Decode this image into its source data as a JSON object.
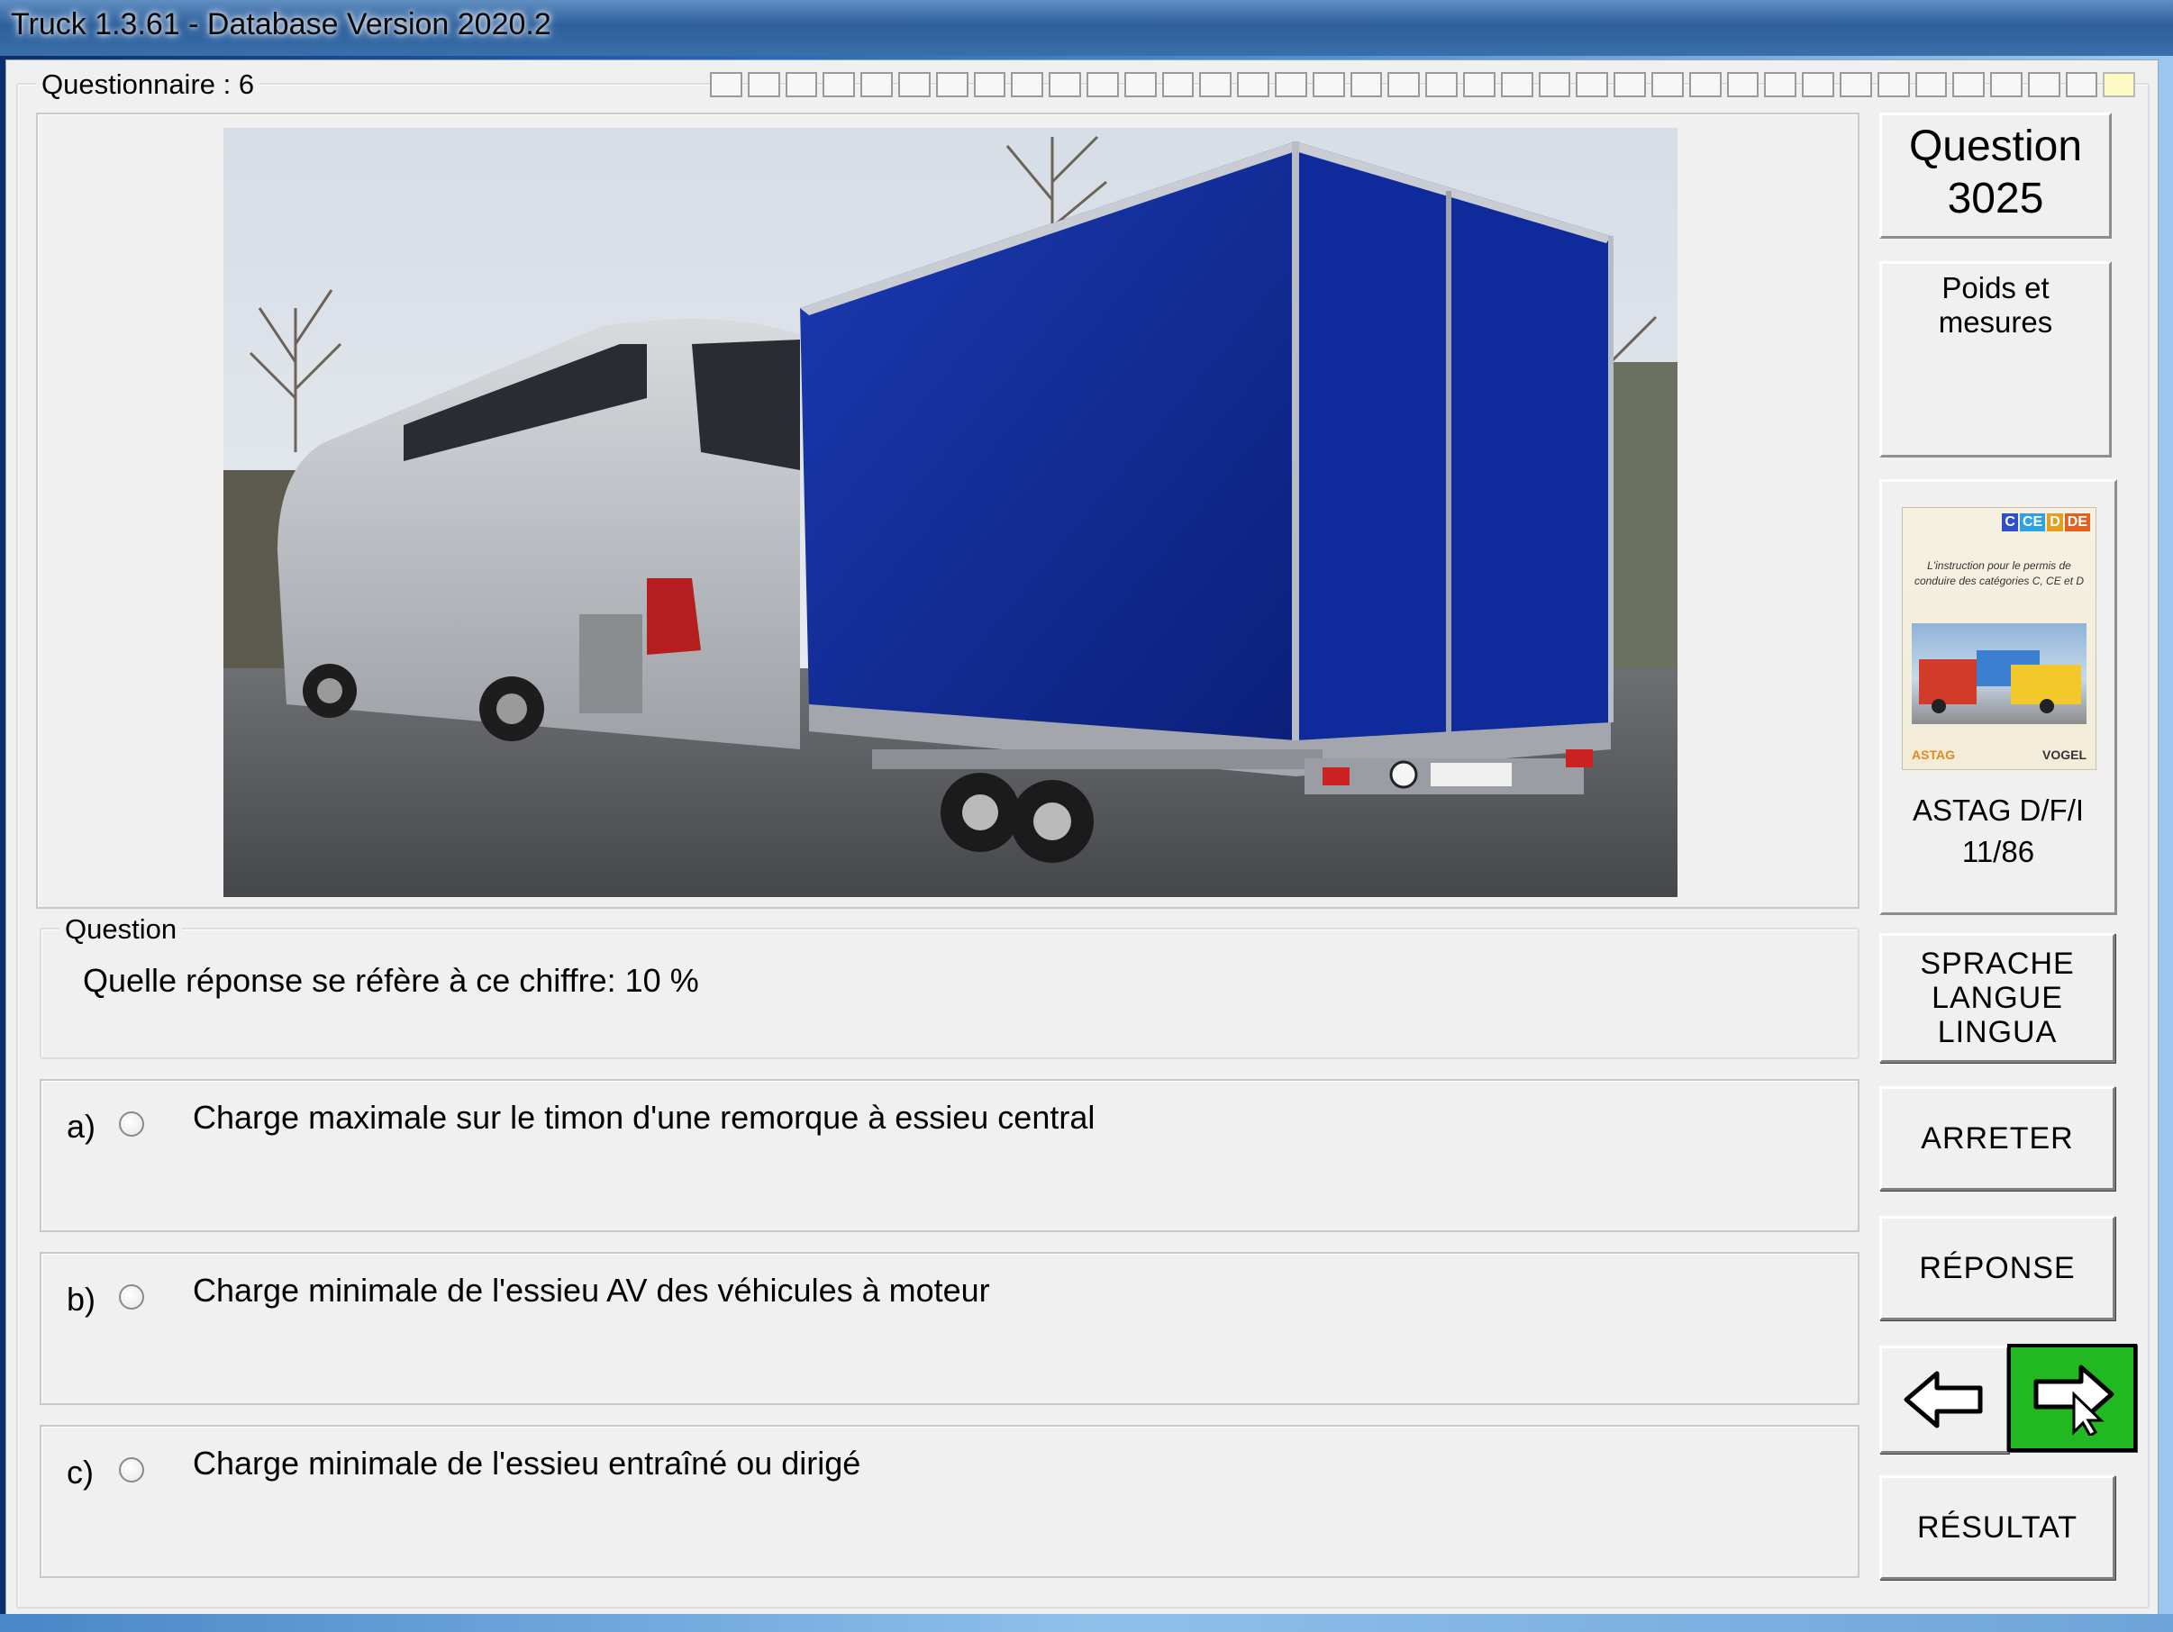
{
  "window": {
    "title": "Truck 1.3.61 - Database Version 2020.2"
  },
  "questionnaire": {
    "label": "Questionnaire : 6",
    "progress_total": 38,
    "progress_current": 38
  },
  "question_box": {
    "title_line1": "Question",
    "number": "3025",
    "category": "Poids et mesures"
  },
  "book": {
    "tags": [
      "C",
      "CE",
      "D",
      "DE"
    ],
    "cover_text": "L'instruction pour le permis de conduire des catégories C, CE et D",
    "logo_left": "ASTAG",
    "logo_right": "VOGEL",
    "caption_line1": "ASTAG D/F/I",
    "caption_line2": "11/86"
  },
  "question": {
    "group_label": "Question",
    "text": "Quelle réponse se réfère à ce chiffre:  10 %"
  },
  "answers": [
    {
      "letter": "a)",
      "text": "Charge maximale sur le timon d'une remorque à essieu central"
    },
    {
      "letter": "b)",
      "text": "Charge minimale de l'essieu AV des véhicules à moteur"
    },
    {
      "letter": "c)",
      "text": "Charge minimale de l'essieu entraîné ou dirigé"
    }
  ],
  "buttons": {
    "language_line1": "SPRACHE",
    "language_line2": "LANGUE",
    "language_line3": "LINGUA",
    "stop": "ARRETER",
    "answer": "RÉPONSE",
    "result": "RÉSULTAT"
  },
  "colors": {
    "next_button": "#22b822",
    "trailer_blue": "#0f2a9a",
    "bus_silver": "#b9bcc3"
  },
  "icons": {
    "prev": "arrow-left-icon",
    "next": "arrow-right-icon"
  }
}
